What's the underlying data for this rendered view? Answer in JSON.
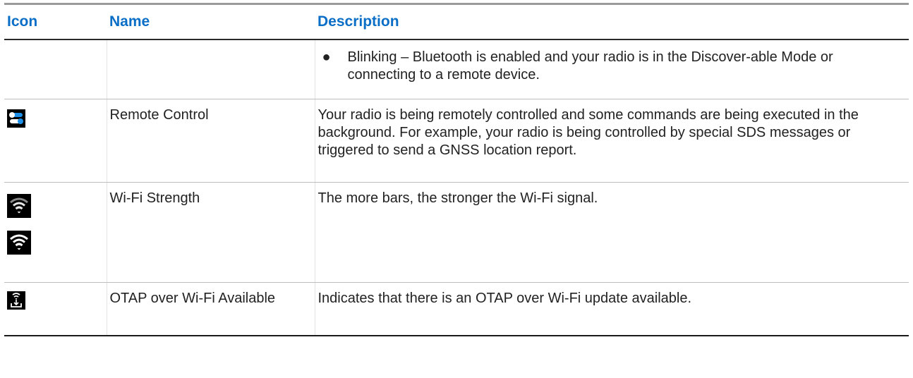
{
  "table": {
    "headers": {
      "icon": "Icon",
      "name": "Name",
      "description": "Description"
    },
    "rows": [
      {
        "name": "",
        "bullet": "●",
        "bullet_text": "Blinking – Bluetooth is enabled and your radio is in the Discover-able Mode or connecting to a remote device."
      },
      {
        "icon": "remote-control-icon",
        "name": "Remote Control",
        "description": "Your radio is being remotely controlled and some commands are being executed in the background. For example, your radio is being controlled by special SDS messages or triggered to send a GNSS location report."
      },
      {
        "icons": [
          "wifi-strength-partial-icon",
          "wifi-strength-full-icon"
        ],
        "name": "Wi-Fi Strength",
        "description": "The more bars, the stronger the Wi-Fi signal."
      },
      {
        "icon": "otap-download-icon",
        "name": "OTAP over Wi-Fi Available",
        "description": "Indicates that there is an OTAP over Wi-Fi update available."
      }
    ]
  },
  "colors": {
    "header_text": "#0a6ec6",
    "remote_icon_accent": "#1e8fe6"
  }
}
